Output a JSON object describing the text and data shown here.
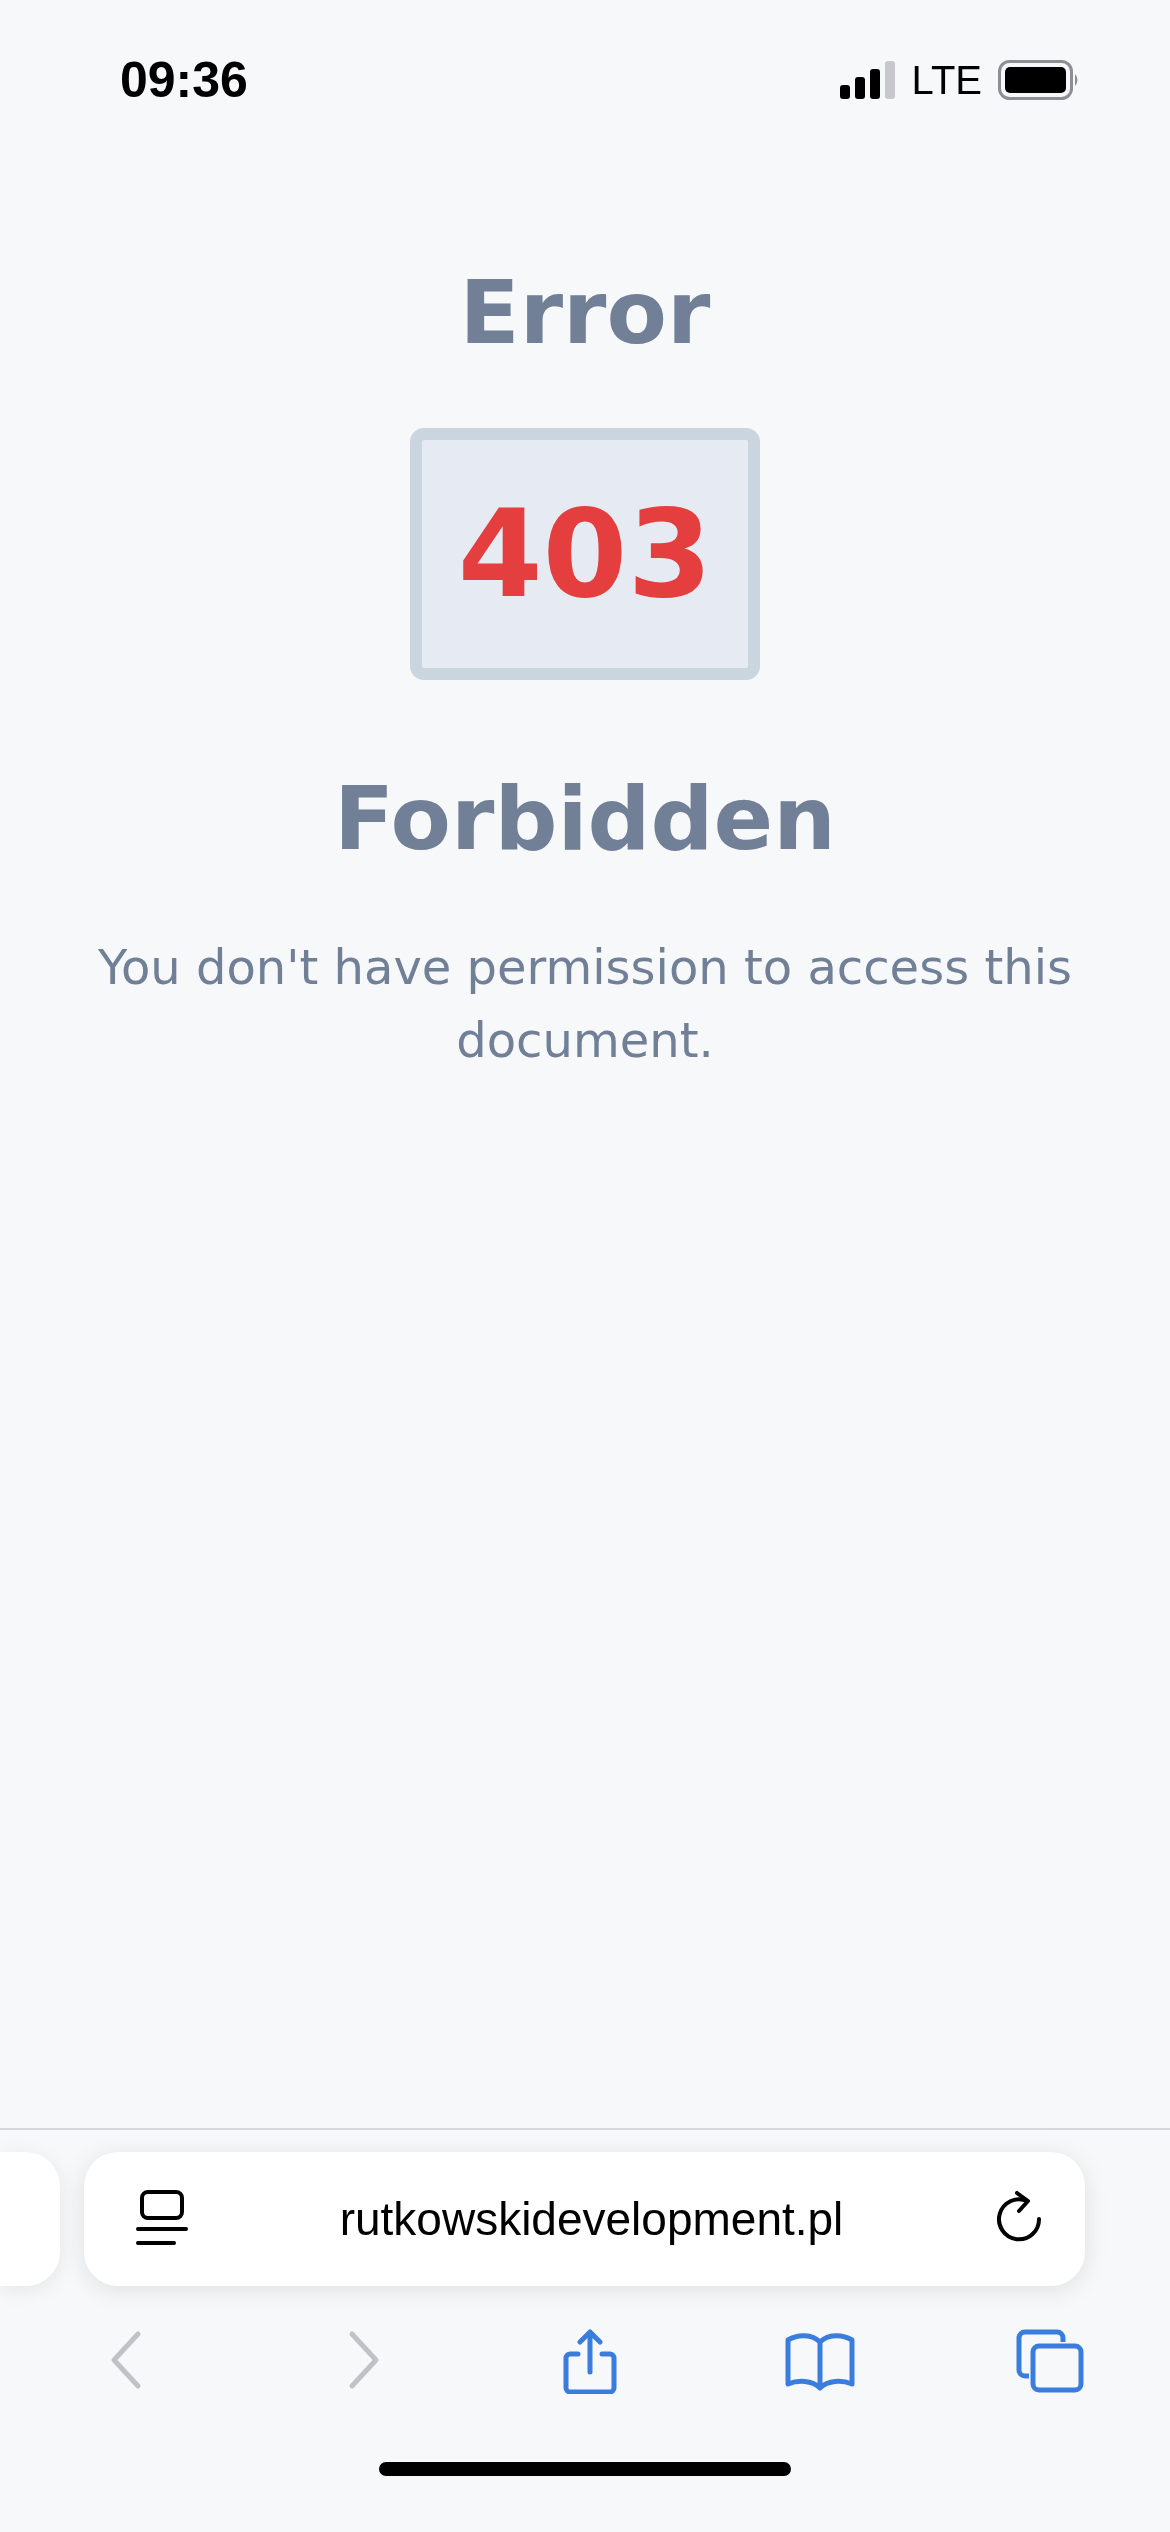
{
  "status_bar": {
    "time": "09:36",
    "network": "LTE"
  },
  "page": {
    "heading": "Error",
    "code": "403",
    "title": "Forbidden",
    "message": "You don't have permission to access this document."
  },
  "address_bar": {
    "url": "rutkowskidevelopment.pl"
  },
  "toolbar": [
    {
      "kind": "back",
      "disabled": true
    },
    {
      "kind": "forward",
      "disabled": true
    },
    {
      "kind": "share",
      "disabled": false
    },
    {
      "kind": "bookmarks",
      "disabled": false
    },
    {
      "kind": "tabs",
      "disabled": false
    }
  ]
}
